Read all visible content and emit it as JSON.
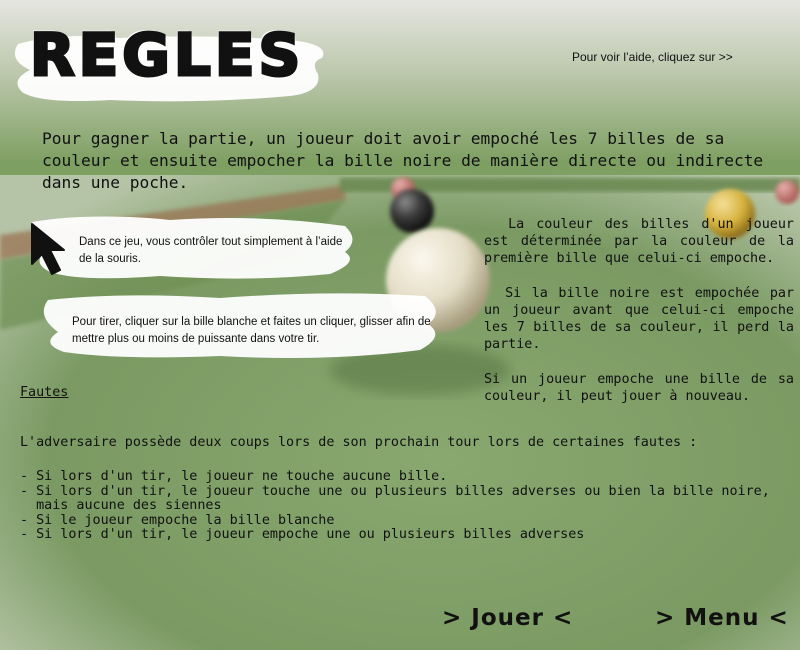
{
  "title": "REGLES",
  "help_text": "Pour voir l’aide, cliquez sur  >>",
  "intro": "Pour gagner la partie, un joueur doit avoir empoché les 7 billes de sa couleur et ensuite empocher la bille noire de manière directe ou indirecte dans une poche.",
  "tips": {
    "mouse": "Dans ce jeu, vous contrôler tout simplement à l’aide de la souris.",
    "shoot": "Pour tirer, cliquer sur la bille blanche et faites un cliquer, glisser afin de mettre plus ou moins de puissante dans votre tir."
  },
  "right_rules": [
    "  La couleur des billes d'un joueur est déterminée par la couleur de la première bille que celui-ci empoche.",
    "  Si la bille noire est empochée par un joueur avant que celui-ci empoche les 7 billes de sa couleur, il perd la partie.",
    "Si un joueur empoche une bille de sa couleur, il peut jouer à nouveau."
  ],
  "fautes": {
    "title": "Fautes",
    "intro": "L'adversaire possède deux coups lors de son prochain tour lors de certaines fautes :",
    "items": [
      "- Si lors d'un tir, le joueur ne touche aucune bille.",
      "- Si lors d'un tir, le joueur touche une ou plusieurs billes adverses ou bien la bille noire,\n  mais aucune des siennes",
      "- Si le joueur empoche la bille blanche",
      "- Si lors d'un tir, le joueur empoche une ou plusieurs billes adverses"
    ]
  },
  "buttons": {
    "play": "> Jouer <",
    "menu": "> Menu <"
  },
  "colors": {
    "felt": "#7f9f5e",
    "felt_dark": "#5e7d45",
    "rail": "#a57a58",
    "white_ball": "#e8e2cf",
    "black_ball": "#2d2d2d",
    "yellow_ball": "#d9b63b",
    "red_ball": "#c77a78"
  }
}
